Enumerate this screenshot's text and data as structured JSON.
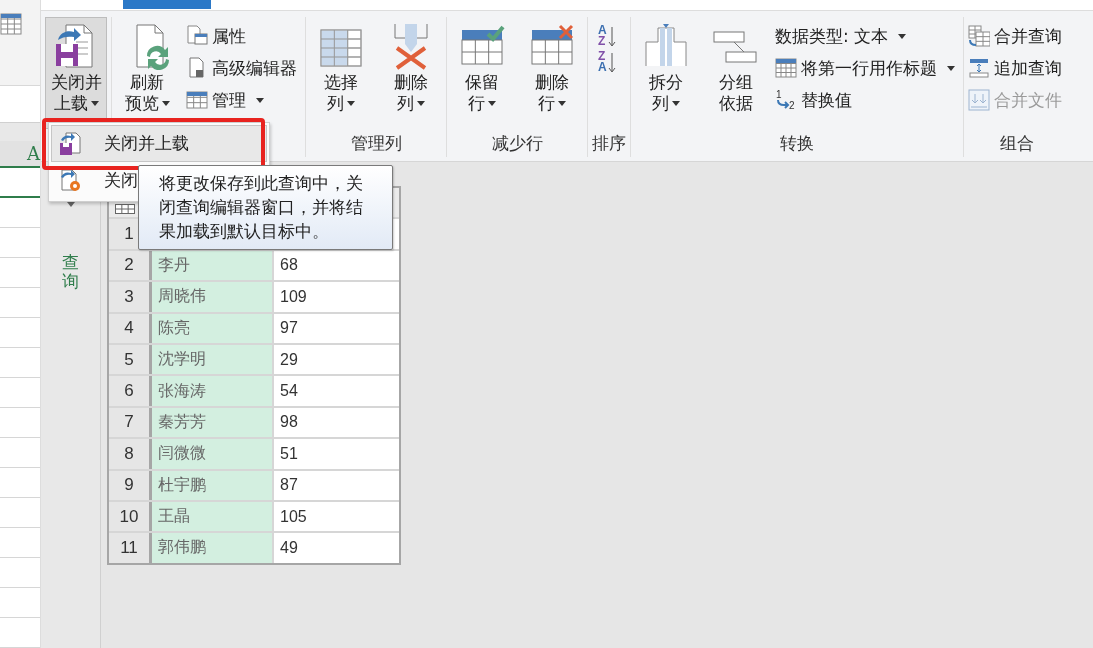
{
  "spreadsheet": {
    "column_header": "A"
  },
  "ribbon": {
    "groups": [
      {
        "items": [
          {
            "kind": "large",
            "lines": [
              "关闭并",
              "上载"
            ],
            "dropdown": true,
            "pressed": true
          }
        ]
      },
      {
        "items": [
          {
            "kind": "large",
            "lines": [
              "刷新",
              "预览"
            ],
            "dropdown": true,
            "pressed": false
          },
          {
            "kind": "stack",
            "entries": [
              {
                "label": "属性",
                "dropdown": false,
                "disabled": false
              },
              {
                "label": "高级编辑器",
                "dropdown": false,
                "disabled": false
              },
              {
                "label": "管理",
                "dropdown": true,
                "disabled": false
              }
            ]
          }
        ]
      },
      {
        "label": "管理列",
        "items": [
          {
            "kind": "large",
            "lines": [
              "选择",
              "列"
            ],
            "dropdown": true,
            "pressed": false
          },
          {
            "kind": "large",
            "lines": [
              "删除",
              "列"
            ],
            "dropdown": true,
            "pressed": false
          }
        ]
      },
      {
        "label": "减少行",
        "items": [
          {
            "kind": "large",
            "lines": [
              "保留",
              "行"
            ],
            "dropdown": true,
            "pressed": false
          },
          {
            "kind": "large",
            "lines": [
              "删除",
              "行"
            ],
            "dropdown": true,
            "pressed": false
          }
        ]
      },
      {
        "label": "排序",
        "items": [
          {
            "kind": "sort",
            "entries": [
              {
                "top": "A",
                "bottom": "Z"
              },
              {
                "top": "Z",
                "bottom": "A"
              }
            ]
          }
        ]
      },
      {
        "label": "转换",
        "items": [
          {
            "kind": "large",
            "lines": [
              "拆分",
              "列"
            ],
            "dropdown": true,
            "pressed": false
          },
          {
            "kind": "large",
            "lines": [
              "分组",
              "依据"
            ],
            "dropdown": false,
            "pressed": false
          },
          {
            "kind": "stack",
            "entries": [
              {
                "label": "数据类型: 文本",
                "dropdown": true,
                "disabled": false
              },
              {
                "label": "将第一行用作标题",
                "dropdown": true,
                "disabled": false
              },
              {
                "label": "替换值",
                "dropdown": false,
                "disabled": false,
                "marks": [
                  "1",
                  "2"
                ]
              }
            ]
          }
        ]
      },
      {
        "label": "组合",
        "items": [
          {
            "kind": "stack",
            "entries": [
              {
                "label": "合并查询",
                "dropdown": false,
                "disabled": false
              },
              {
                "label": "追加查询",
                "dropdown": false,
                "disabled": false
              },
              {
                "label": "合并文件",
                "dropdown": false,
                "disabled": true
              }
            ]
          }
        ]
      }
    ]
  },
  "queries_pane": {
    "label": "查询"
  },
  "table": {
    "rows": [
      {
        "index": "1"
      },
      {
        "index": "2",
        "name": "李丹",
        "value": "68"
      },
      {
        "index": "3",
        "name": "周晓伟",
        "value": "109"
      },
      {
        "index": "4",
        "name": "陈亮",
        "value": "97"
      },
      {
        "index": "5",
        "name": "沈学明",
        "value": "29"
      },
      {
        "index": "6",
        "name": "张海涛",
        "value": "54"
      },
      {
        "index": "7",
        "name": "秦芳芳",
        "value": "98"
      },
      {
        "index": "8",
        "name": "闫微微",
        "value": "51"
      },
      {
        "index": "9",
        "name": "杜宇鹏",
        "value": "87"
      },
      {
        "index": "10",
        "name": "王晶",
        "value": "105"
      },
      {
        "index": "11",
        "name": "郭伟鹏",
        "value": "49"
      }
    ]
  },
  "menu": {
    "items": [
      {
        "label": "关闭并上载",
        "selected": true
      },
      {
        "label": "关闭",
        "selected": false
      }
    ]
  },
  "tooltip": {
    "text": "将更改保存到此查询中，关闭查询编辑器窗口，并将结果加载到默认目标中。"
  }
}
